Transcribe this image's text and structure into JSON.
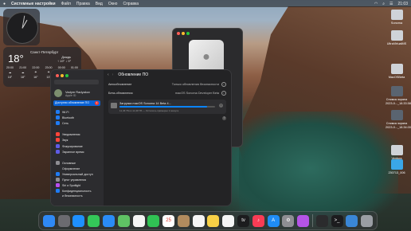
{
  "menubar": {
    "app_name": "Системные настройки",
    "menus": [
      "Файл",
      "Правка",
      "Вид",
      "Окно",
      "Справка"
    ],
    "clock": "21:03"
  },
  "weather": {
    "city": "Санкт-Петербург",
    "temp": "18°",
    "condition": "Дождь",
    "range": "↑ 19° ↓ 9°",
    "hours": [
      {
        "t": "20:00",
        "v": "18°"
      },
      {
        "t": "21:00",
        "v": "18°"
      },
      {
        "t": "22:00",
        "v": "16°"
      },
      {
        "t": "23:00",
        "v": "13°"
      },
      {
        "t": "00:00",
        "v": "12°"
      },
      {
        "t": "01:00",
        "v": "10°"
      }
    ]
  },
  "settings": {
    "user_name": "Vadym Radyakov",
    "user_sub": "Apple ID",
    "selected_item": "Доступно обновление ПО",
    "selected_badge": "1",
    "sidebar": [
      {
        "label": "Wi-Fi",
        "icon": "wifi-icon",
        "color": "#1e7cf5"
      },
      {
        "label": "Bluetooth",
        "icon": "bluetooth-icon",
        "color": "#1e7cf5"
      },
      {
        "label": "Сеть",
        "icon": "network-icon",
        "color": "#1e7cf5"
      },
      {
        "label": "Уведомления",
        "icon": "bell-icon",
        "color": "#ff453a"
      },
      {
        "label": "Звук",
        "icon": "speaker-icon",
        "color": "#ff453a"
      },
      {
        "label": "Фокусирование",
        "icon": "moon-icon",
        "color": "#5e5ce6"
      },
      {
        "label": "Экранное время",
        "icon": "hourglass-icon",
        "color": "#5e5ce6"
      },
      {
        "label": "Основные",
        "icon": "gear-icon",
        "color": "#8e8e93"
      },
      {
        "label": "Оформление",
        "icon": "appearance-icon",
        "color": "#2c2c2e"
      },
      {
        "label": "Универсальный доступ",
        "icon": "accessibility-icon",
        "color": "#1e7cf5"
      },
      {
        "label": "Пункт управления",
        "icon": "control-center-icon",
        "color": "#8e8e93"
      },
      {
        "label": "Siri и Spotlight",
        "icon": "siri-icon",
        "color": "#b84ef0"
      },
      {
        "label": "Конфиденциальность",
        "icon": "hand-icon",
        "color": "#1e7cf5"
      },
      {
        "label": "и безопасность",
        "icon": "",
        "color": "transparent"
      }
    ],
    "header_title": "Обновление ПО",
    "rows": [
      {
        "label": "Автообновление",
        "value": "Только обновления безопасности"
      },
      {
        "label": "Бета-обновления",
        "value": "macOS Sonoma Developer Beta"
      }
    ],
    "download": {
      "title": "Загрузка macOS Sonoma 14 Beta 4...",
      "status": "11,46 ГБ из 12,48 ГБ — Осталось примерно 1 минута",
      "progress": 0.92
    },
    "help": "?"
  },
  "desktop_icons": [
    {
      "label1": "Sonoma",
      "label2": "",
      "color": "#cfd3d8"
    },
    {
      "label1": "UltraVirtualMS",
      "label2": "",
      "color": "#cfd3d8"
    },
    {
      "label1": "MacOSBeta",
      "label2": "",
      "color": "#cfd3d8"
    },
    {
      "label1": "Снимок экрана",
      "label2": "2023-0..._18.33.58",
      "color": "#5a6470"
    },
    {
      "label1": "Снимок экрана",
      "label2": "2023-0..._18.34.00",
      "color": "#5a6470"
    },
    {
      "label1": "Ventura",
      "label2": "",
      "color": "#cfd3d8"
    },
    {
      "label1": "230713_006",
      "label2": "",
      "color": "#3aa7e8"
    }
  ],
  "dock": [
    {
      "icon": "finder-icon",
      "color": "#2f89f5",
      "glyph": ""
    },
    {
      "icon": "launchpad-icon",
      "color": "#6b6b70",
      "glyph": ""
    },
    {
      "icon": "safari-icon",
      "color": "#1e90ff",
      "glyph": ""
    },
    {
      "icon": "messages-icon",
      "color": "#34c759",
      "glyph": ""
    },
    {
      "icon": "mail-icon",
      "color": "#2a8cf7",
      "glyph": ""
    },
    {
      "icon": "maps-icon",
      "color": "#5fc264",
      "glyph": ""
    },
    {
      "icon": "photos-icon",
      "color": "#f5f5f5",
      "glyph": ""
    },
    {
      "icon": "facetime-icon",
      "color": "#30c254",
      "glyph": ""
    },
    {
      "icon": "calendar-icon",
      "color": "#ffffff",
      "glyph": "25"
    },
    {
      "icon": "contacts-icon",
      "color": "#b18b5e",
      "glyph": ""
    },
    {
      "icon": "reminders-icon",
      "color": "#f5f5f5",
      "glyph": ""
    },
    {
      "icon": "notes-icon",
      "color": "#f7d046",
      "glyph": ""
    },
    {
      "icon": "freeform-icon",
      "color": "#f5f5f5",
      "glyph": ""
    },
    {
      "icon": "tv-icon",
      "color": "#1c1c1e",
      "glyph": "tv"
    },
    {
      "icon": "music-icon",
      "color": "#fa3c55",
      "glyph": "♪"
    },
    {
      "icon": "app-store-icon",
      "color": "#1f8cf5",
      "glyph": "A"
    },
    {
      "icon": "system-settings-icon",
      "color": "#8e8e93",
      "glyph": "⚙"
    },
    {
      "icon": "podcasts-icon",
      "color": "#b554e6",
      "glyph": ""
    },
    {
      "icon": "activity-monitor-icon",
      "color": "#2b2b2d",
      "glyph": ""
    },
    {
      "icon": "terminal-icon",
      "color": "#1c1c1e",
      "glyph": ">_"
    },
    {
      "icon": "downloads-icon",
      "color": "#3a86d6",
      "glyph": ""
    },
    {
      "icon": "trash-icon",
      "color": "#9a9ea4",
      "glyph": ""
    }
  ]
}
